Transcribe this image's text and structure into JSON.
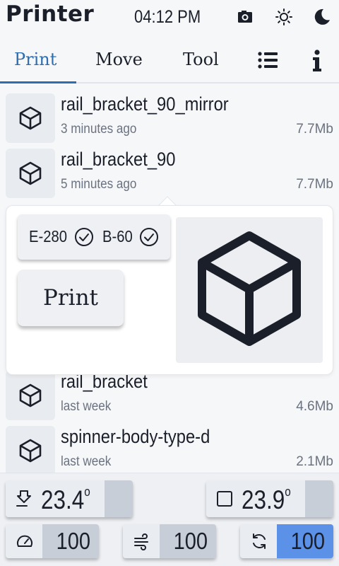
{
  "header": {
    "title": "Printer",
    "clock": "04:12 PM",
    "icons": [
      "camera-icon",
      "brightness-icon",
      "dark-mode-icon"
    ]
  },
  "tabs": [
    {
      "label": "Print",
      "active": true
    },
    {
      "label": "Move",
      "active": false
    },
    {
      "label": "Tool",
      "active": false
    },
    {
      "icon": "list-icon"
    },
    {
      "icon": "info-icon"
    }
  ],
  "files": [
    {
      "name": "rail_bracket_90_mirror",
      "time": "3 minutes ago",
      "size": "7.7Mb"
    },
    {
      "name": "rail_bracket_90",
      "time": "5 minutes ago",
      "size": "7.7Mb"
    },
    {
      "name": "rail_bracket",
      "time": "last week",
      "size": "4.6Mb"
    },
    {
      "name": "spinner-body-type-d",
      "time": "last week",
      "size": "2.1Mb"
    }
  ],
  "detail": {
    "filaments": [
      {
        "label": "E-280",
        "ok": true
      },
      {
        "label": "B-60",
        "ok": true
      }
    ],
    "print_label": "Print",
    "preview_icon": "cube-icon"
  },
  "footer": {
    "extruder": {
      "value": "23.4",
      "unit": "o",
      "heat_fraction": 0.22
    },
    "bed": {
      "value": "23.9",
      "unit": "o",
      "heat_fraction": 0.22
    },
    "speed": {
      "value": "100"
    },
    "flow": {
      "value": "100"
    },
    "fan": {
      "value": "100",
      "highlight": true
    }
  },
  "colors": {
    "accent": "#2e6db0",
    "fan_highlight": "#5b91e6",
    "background": "#f6f7f9"
  }
}
